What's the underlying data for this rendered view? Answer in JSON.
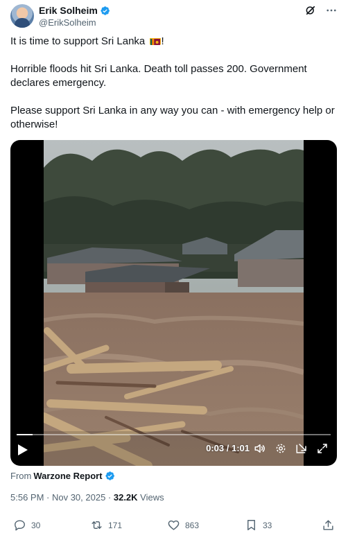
{
  "author": {
    "display_name": "Erik Solheim",
    "handle": "@ErikSolheim",
    "verified": true
  },
  "tweet": {
    "line1_text": "It is time to support Sri Lanka",
    "line1_suffix": "!",
    "flag_emoji": "sri-lanka-flag",
    "paragraph2": "Horrible floods hit Sri Lanka. Death toll passes 200. Government declares emergency.",
    "paragraph3": "Please support Sri Lanka in any way you can - with emergency help or otherwise!"
  },
  "video": {
    "time": "0:03 / 1:01",
    "progress_fraction": 0.05
  },
  "source": {
    "prefix": "From",
    "name": "Warzone Report",
    "verified": true
  },
  "meta": {
    "timestamp": "5:56 PM · Nov 30, 2025 · ",
    "views_count": "32.2K",
    "views_label": " Views"
  },
  "actions": {
    "replies": "30",
    "reposts": "171",
    "likes": "863",
    "bookmarks": "33"
  },
  "colors": {
    "verified_blue": "#1d9bf0",
    "text_primary": "#0f1419",
    "text_secondary": "#536471"
  }
}
